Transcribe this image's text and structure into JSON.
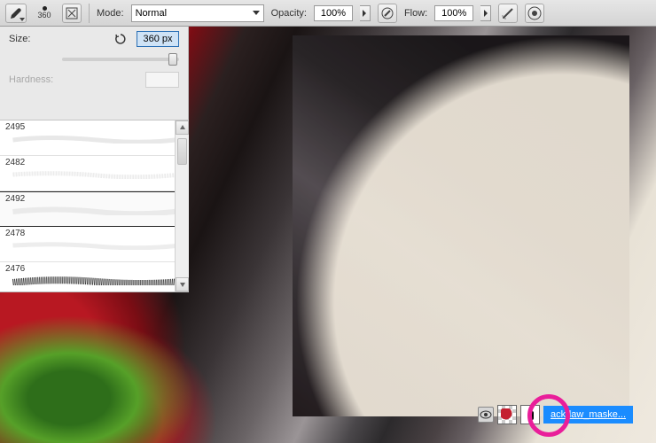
{
  "toolbar": {
    "mode_label": "Mode:",
    "mode_value": "Normal",
    "opacity_label": "Opacity:",
    "opacity_value": "100%",
    "flow_label": "Flow:",
    "flow_value": "100%",
    "brush_preview_size": "360"
  },
  "brush_panel": {
    "size_label": "Size:",
    "size_value": "360 px",
    "hardness_label": "Hardness:",
    "hardness_value": ""
  },
  "brush_presets": [
    {
      "number": "2495",
      "selected": false
    },
    {
      "number": "2482",
      "selected": false
    },
    {
      "number": "2492",
      "selected": true
    },
    {
      "number": "2478",
      "selected": false
    },
    {
      "number": "2476",
      "selected": false
    }
  ],
  "layer": {
    "name": "ackdaw_maske..."
  },
  "colors": {
    "selection_border": "#2a6fb5",
    "selection_fill": "#cfe3f6",
    "layer_highlight": "#1a8cff",
    "annotation_ring": "#e91e9a"
  }
}
